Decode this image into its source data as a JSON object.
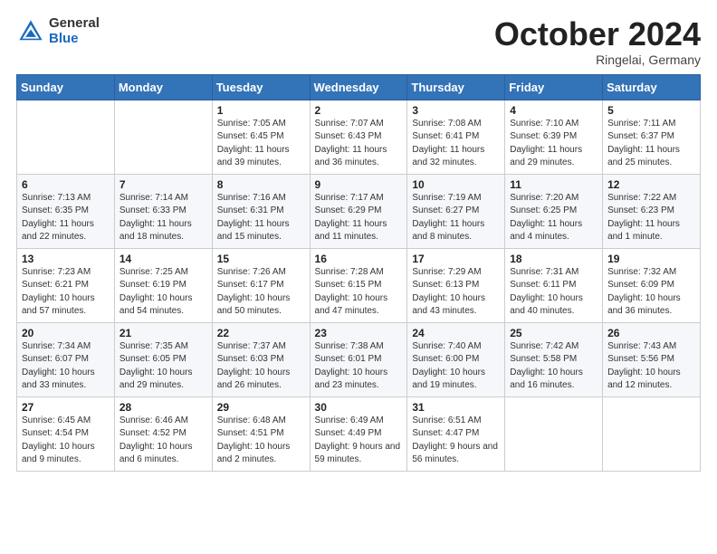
{
  "header": {
    "logo_general": "General",
    "logo_blue": "Blue",
    "month_title": "October 2024",
    "subtitle": "Ringelai, Germany"
  },
  "columns": [
    "Sunday",
    "Monday",
    "Tuesday",
    "Wednesday",
    "Thursday",
    "Friday",
    "Saturday"
  ],
  "weeks": [
    [
      {
        "day": "",
        "sunrise": "",
        "sunset": "",
        "daylight": ""
      },
      {
        "day": "",
        "sunrise": "",
        "sunset": "",
        "daylight": ""
      },
      {
        "day": "1",
        "sunrise": "Sunrise: 7:05 AM",
        "sunset": "Sunset: 6:45 PM",
        "daylight": "Daylight: 11 hours and 39 minutes."
      },
      {
        "day": "2",
        "sunrise": "Sunrise: 7:07 AM",
        "sunset": "Sunset: 6:43 PM",
        "daylight": "Daylight: 11 hours and 36 minutes."
      },
      {
        "day": "3",
        "sunrise": "Sunrise: 7:08 AM",
        "sunset": "Sunset: 6:41 PM",
        "daylight": "Daylight: 11 hours and 32 minutes."
      },
      {
        "day": "4",
        "sunrise": "Sunrise: 7:10 AM",
        "sunset": "Sunset: 6:39 PM",
        "daylight": "Daylight: 11 hours and 29 minutes."
      },
      {
        "day": "5",
        "sunrise": "Sunrise: 7:11 AM",
        "sunset": "Sunset: 6:37 PM",
        "daylight": "Daylight: 11 hours and 25 minutes."
      }
    ],
    [
      {
        "day": "6",
        "sunrise": "Sunrise: 7:13 AM",
        "sunset": "Sunset: 6:35 PM",
        "daylight": "Daylight: 11 hours and 22 minutes."
      },
      {
        "day": "7",
        "sunrise": "Sunrise: 7:14 AM",
        "sunset": "Sunset: 6:33 PM",
        "daylight": "Daylight: 11 hours and 18 minutes."
      },
      {
        "day": "8",
        "sunrise": "Sunrise: 7:16 AM",
        "sunset": "Sunset: 6:31 PM",
        "daylight": "Daylight: 11 hours and 15 minutes."
      },
      {
        "day": "9",
        "sunrise": "Sunrise: 7:17 AM",
        "sunset": "Sunset: 6:29 PM",
        "daylight": "Daylight: 11 hours and 11 minutes."
      },
      {
        "day": "10",
        "sunrise": "Sunrise: 7:19 AM",
        "sunset": "Sunset: 6:27 PM",
        "daylight": "Daylight: 11 hours and 8 minutes."
      },
      {
        "day": "11",
        "sunrise": "Sunrise: 7:20 AM",
        "sunset": "Sunset: 6:25 PM",
        "daylight": "Daylight: 11 hours and 4 minutes."
      },
      {
        "day": "12",
        "sunrise": "Sunrise: 7:22 AM",
        "sunset": "Sunset: 6:23 PM",
        "daylight": "Daylight: 11 hours and 1 minute."
      }
    ],
    [
      {
        "day": "13",
        "sunrise": "Sunrise: 7:23 AM",
        "sunset": "Sunset: 6:21 PM",
        "daylight": "Daylight: 10 hours and 57 minutes."
      },
      {
        "day": "14",
        "sunrise": "Sunrise: 7:25 AM",
        "sunset": "Sunset: 6:19 PM",
        "daylight": "Daylight: 10 hours and 54 minutes."
      },
      {
        "day": "15",
        "sunrise": "Sunrise: 7:26 AM",
        "sunset": "Sunset: 6:17 PM",
        "daylight": "Daylight: 10 hours and 50 minutes."
      },
      {
        "day": "16",
        "sunrise": "Sunrise: 7:28 AM",
        "sunset": "Sunset: 6:15 PM",
        "daylight": "Daylight: 10 hours and 47 minutes."
      },
      {
        "day": "17",
        "sunrise": "Sunrise: 7:29 AM",
        "sunset": "Sunset: 6:13 PM",
        "daylight": "Daylight: 10 hours and 43 minutes."
      },
      {
        "day": "18",
        "sunrise": "Sunrise: 7:31 AM",
        "sunset": "Sunset: 6:11 PM",
        "daylight": "Daylight: 10 hours and 40 minutes."
      },
      {
        "day": "19",
        "sunrise": "Sunrise: 7:32 AM",
        "sunset": "Sunset: 6:09 PM",
        "daylight": "Daylight: 10 hours and 36 minutes."
      }
    ],
    [
      {
        "day": "20",
        "sunrise": "Sunrise: 7:34 AM",
        "sunset": "Sunset: 6:07 PM",
        "daylight": "Daylight: 10 hours and 33 minutes."
      },
      {
        "day": "21",
        "sunrise": "Sunrise: 7:35 AM",
        "sunset": "Sunset: 6:05 PM",
        "daylight": "Daylight: 10 hours and 29 minutes."
      },
      {
        "day": "22",
        "sunrise": "Sunrise: 7:37 AM",
        "sunset": "Sunset: 6:03 PM",
        "daylight": "Daylight: 10 hours and 26 minutes."
      },
      {
        "day": "23",
        "sunrise": "Sunrise: 7:38 AM",
        "sunset": "Sunset: 6:01 PM",
        "daylight": "Daylight: 10 hours and 23 minutes."
      },
      {
        "day": "24",
        "sunrise": "Sunrise: 7:40 AM",
        "sunset": "Sunset: 6:00 PM",
        "daylight": "Daylight: 10 hours and 19 minutes."
      },
      {
        "day": "25",
        "sunrise": "Sunrise: 7:42 AM",
        "sunset": "Sunset: 5:58 PM",
        "daylight": "Daylight: 10 hours and 16 minutes."
      },
      {
        "day": "26",
        "sunrise": "Sunrise: 7:43 AM",
        "sunset": "Sunset: 5:56 PM",
        "daylight": "Daylight: 10 hours and 12 minutes."
      }
    ],
    [
      {
        "day": "27",
        "sunrise": "Sunrise: 6:45 AM",
        "sunset": "Sunset: 4:54 PM",
        "daylight": "Daylight: 10 hours and 9 minutes."
      },
      {
        "day": "28",
        "sunrise": "Sunrise: 6:46 AM",
        "sunset": "Sunset: 4:52 PM",
        "daylight": "Daylight: 10 hours and 6 minutes."
      },
      {
        "day": "29",
        "sunrise": "Sunrise: 6:48 AM",
        "sunset": "Sunset: 4:51 PM",
        "daylight": "Daylight: 10 hours and 2 minutes."
      },
      {
        "day": "30",
        "sunrise": "Sunrise: 6:49 AM",
        "sunset": "Sunset: 4:49 PM",
        "daylight": "Daylight: 9 hours and 59 minutes."
      },
      {
        "day": "31",
        "sunrise": "Sunrise: 6:51 AM",
        "sunset": "Sunset: 4:47 PM",
        "daylight": "Daylight: 9 hours and 56 minutes."
      },
      {
        "day": "",
        "sunrise": "",
        "sunset": "",
        "daylight": ""
      },
      {
        "day": "",
        "sunrise": "",
        "sunset": "",
        "daylight": ""
      }
    ]
  ]
}
